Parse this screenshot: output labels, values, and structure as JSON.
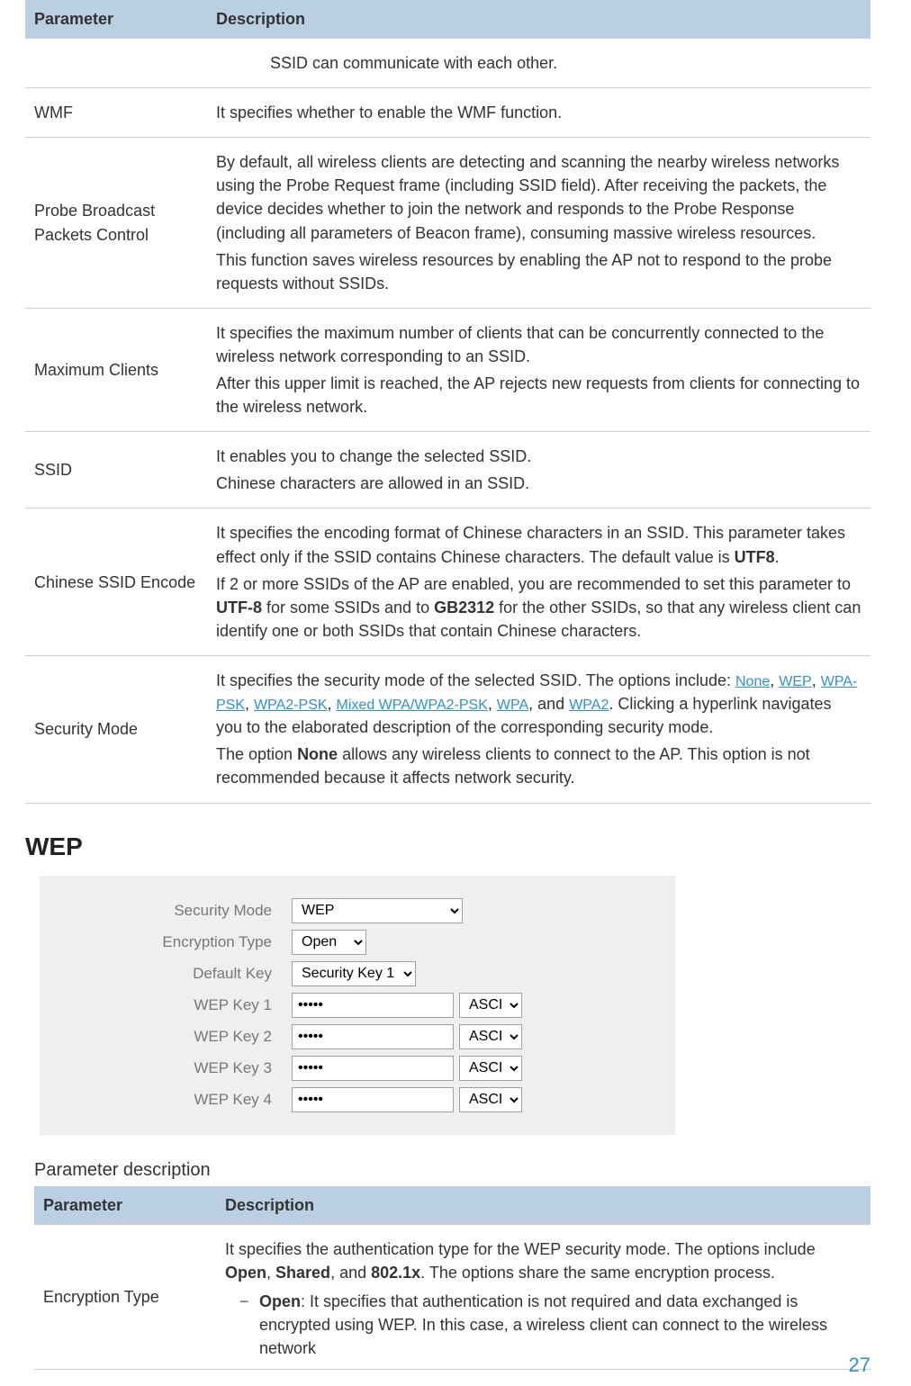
{
  "page_number": "27",
  "table1": {
    "headers": {
      "param": "Parameter",
      "desc": "Description"
    },
    "rows": [
      {
        "param": "",
        "desc_p1": "SSID can communicate with each other."
      },
      {
        "param": "WMF",
        "desc_p1": "It specifies whether to enable the WMF function."
      },
      {
        "param": "Probe Broadcast Packets Control",
        "desc_p1": "By default, all wireless clients are detecting and scanning the nearby wireless networks using the Probe Request frame (including SSID field). After receiving the packets, the device decides whether to join the network and responds to the Probe Response (including all parameters of Beacon frame), consuming massive wireless resources.",
        "desc_p2": "This function saves wireless resources by enabling the AP not to respond to the probe requests without SSIDs."
      },
      {
        "param": "Maximum Clients",
        "desc_p1": "It specifies the maximum number of clients that can be concurrently connected to the wireless network corresponding to an SSID.",
        "desc_p2": "After this upper limit is reached, the AP rejects new requests from clients for connecting to the wireless network."
      },
      {
        "param": "SSID",
        "desc_p1": "It enables you to change the selected SSID.",
        "desc_p2": "Chinese characters are allowed in an SSID."
      },
      {
        "param": "Chinese SSID Encode",
        "desc_p1_a": "It specifies the encoding format of Chinese characters in an SSID. This parameter takes effect only if the SSID contains Chinese characters. The default value is ",
        "desc_p1_b": "UTF8",
        "desc_p1_c": ".",
        "desc_p2_a": "If 2 or more SSIDs of the AP are enabled, you are recommended to set this parameter to ",
        "desc_p2_b": "UTF-8",
        "desc_p2_c": " for some SSIDs and to ",
        "desc_p2_d": "GB2312",
        "desc_p2_e": " for the other SSIDs, so that any wireless client can identify one or both SSIDs that contain Chinese characters."
      },
      {
        "param": "Security Mode",
        "desc_p1_a": "It specifies the security mode of the selected SSID. The options include: ",
        "links": [
          "None",
          "WEP",
          "WPA-PSK",
          "WPA2-PSK",
          "Mixed WPA/WPA2-PSK",
          "WPA",
          "WPA2"
        ],
        "desc_p1_b": ". Clicking a hyperlink navigates you to the elaborated description of the corresponding security mode.",
        "desc_p2_a": "The option ",
        "desc_p2_b": "None",
        "desc_p2_c": " allows any wireless clients to connect to the AP. This option is not recommended because it affects network security."
      }
    ]
  },
  "wep_heading": "WEP",
  "wep_form": {
    "labels": {
      "security_mode": "Security Mode",
      "encryption_type": "Encryption Type",
      "default_key": "Default Key",
      "wep_key_1": "WEP Key 1",
      "wep_key_2": "WEP Key 2",
      "wep_key_3": "WEP Key 3",
      "wep_key_4": "WEP Key 4"
    },
    "values": {
      "security_mode": "WEP",
      "encryption_type": "Open",
      "default_key": "Security Key 1",
      "key_value": "•••••",
      "ascii": "ASCII"
    }
  },
  "subhead": "Parameter description",
  "table2": {
    "headers": {
      "param": "Parameter",
      "desc": "Description"
    },
    "row": {
      "param": "Encryption Type",
      "p1_a": "It specifies the authentication type for the WEP security mode. The options include ",
      "p1_b": "Open",
      "p1_c": ", ",
      "p1_d": "Shared",
      "p1_e": ", and ",
      "p1_f": "802.1x",
      "p1_g": ". The options share the same encryption process.",
      "bullet_b": "Open",
      "bullet_rest": ": It specifies that authentication is not required and data exchanged is encrypted using WEP. In this case, a wireless client can connect to the wireless network"
    }
  }
}
